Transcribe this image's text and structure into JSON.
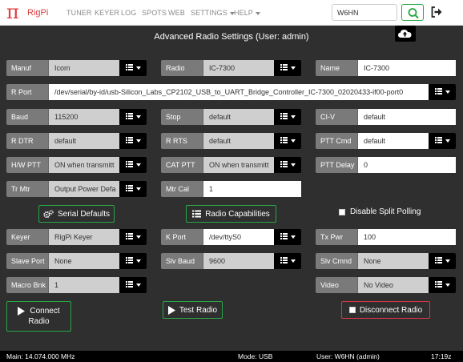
{
  "nav": {
    "brand": "RigPi",
    "brand_symbol": "π",
    "items": [
      "TUNER",
      "KEYER",
      "LOG",
      "SPOTS",
      "WEB",
      "SETTINGS",
      "HELP"
    ],
    "callsign_value": "W6HN"
  },
  "page": {
    "title": "Advanced Radio Settings (User: admin)"
  },
  "fields": {
    "manuf": {
      "label": "Manuf",
      "value": "Icom"
    },
    "radio": {
      "label": "Radio",
      "value": "IC-7300"
    },
    "name": {
      "label": "Name",
      "value": "IC-7300"
    },
    "rport": {
      "label": "R Port",
      "value": "/dev/serial/by-id/usb-Silicon_Labs_CP2102_USB_to_UART_Bridge_Controller_IC-7300_02020433-if00-port0"
    },
    "baud": {
      "label": "Baud",
      "value": "115200"
    },
    "stop": {
      "label": "Stop",
      "value": "default"
    },
    "civ": {
      "label": "CI-V",
      "value": "default"
    },
    "rdtr": {
      "label": "R DTR",
      "value": "default"
    },
    "rrts": {
      "label": "R RTS",
      "value": "default"
    },
    "pttcmd": {
      "label": "PTT Cmd",
      "value": "default"
    },
    "hwptt": {
      "label": "H/W PTT",
      "value": "ON when transmitt"
    },
    "catptt": {
      "label": "CAT PTT",
      "value": "ON when transmitt"
    },
    "pttdelay": {
      "label": "PTT Delay",
      "value": "0"
    },
    "trmtr": {
      "label": "Tr Mtr",
      "value": "Output Power Defa"
    },
    "mtrcal": {
      "label": "Mtr Cal",
      "value": "1"
    },
    "keyer": {
      "label": "Keyer",
      "value": "RigPi Keyer"
    },
    "kport": {
      "label": "K Port",
      "value": "/dev/ttyS0"
    },
    "txpwr": {
      "label": "Tx Pwr",
      "value": "100"
    },
    "slaveport": {
      "label": "Slave Port",
      "value": "None"
    },
    "slvbaud": {
      "label": "Slv Baud",
      "value": "9600"
    },
    "slvcmnd": {
      "label": "Slv Cmnd",
      "value": "None"
    },
    "macrobnk": {
      "label": "Macro Bnk",
      "value": "1"
    },
    "video": {
      "label": "Video",
      "value": "No Video"
    }
  },
  "buttons": {
    "serial_defaults": "Serial Defaults",
    "radio_capabilities": "Radio Capabilities",
    "disable_split": "Disable Split Polling",
    "connect_line1": "Connect",
    "connect_line2": "Radio",
    "test_radio": "Test Radio",
    "disconnect_radio": "Disconnect Radio"
  },
  "status": {
    "main": "Main: 14.074.000 MHz",
    "mode": "Mode: USB",
    "user": "User: W6HN (admin)",
    "time": "17:19z"
  }
}
